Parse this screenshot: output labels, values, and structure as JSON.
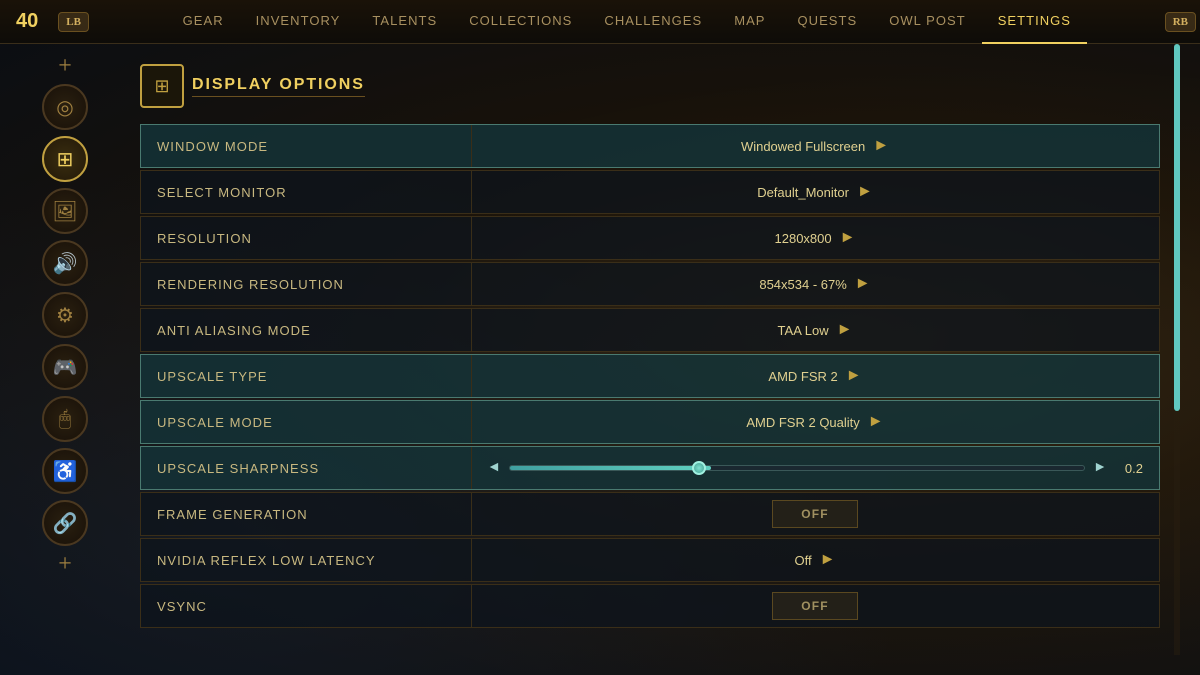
{
  "topbar": {
    "level": "40",
    "lb_label": "LB",
    "rb_label": "RB",
    "nav_items": [
      {
        "label": "GEAR",
        "active": false
      },
      {
        "label": "INVENTORY",
        "active": false
      },
      {
        "label": "TALENTS",
        "active": false
      },
      {
        "label": "COLLECTIONS",
        "active": false
      },
      {
        "label": "CHALLENGES",
        "active": false
      },
      {
        "label": "MAP",
        "active": false
      },
      {
        "label": "QUESTS",
        "active": false
      },
      {
        "label": "OWL POST",
        "active": false
      },
      {
        "label": "SETTINGS",
        "active": true
      }
    ]
  },
  "sidebar": {
    "icons": [
      {
        "name": "plus-top",
        "symbol": "+",
        "active": false
      },
      {
        "name": "disc",
        "symbol": "◎",
        "active": false
      },
      {
        "name": "display",
        "symbol": "⊞",
        "active": true
      },
      {
        "name": "image",
        "symbol": "🖼",
        "active": false
      },
      {
        "name": "audio",
        "symbol": "🔊",
        "active": false
      },
      {
        "name": "gear",
        "symbol": "⚙",
        "active": false
      },
      {
        "name": "gamepad",
        "symbol": "🎮",
        "active": false
      },
      {
        "name": "mouse",
        "symbol": "🖱",
        "active": false
      },
      {
        "name": "accessibility",
        "symbol": "♿",
        "active": false
      },
      {
        "name": "network",
        "symbol": "🔗",
        "active": false
      },
      {
        "name": "plus-bottom",
        "symbol": "+",
        "active": false
      }
    ]
  },
  "section": {
    "title": "DISPLAY OPTIONS",
    "icon": "⊞"
  },
  "settings": [
    {
      "label": "WINDOW MODE",
      "value": "Windowed Fullscreen",
      "type": "dropdown",
      "highlighted": true
    },
    {
      "label": "SELECT MONITOR",
      "value": "Default_Monitor",
      "type": "dropdown",
      "highlighted": false
    },
    {
      "label": "RESOLUTION",
      "value": "1280x800",
      "type": "dropdown",
      "highlighted": false
    },
    {
      "label": "RENDERING RESOLUTION",
      "value": "854x534 - 67%",
      "type": "dropdown",
      "highlighted": false
    },
    {
      "label": "ANTI ALIASING MODE",
      "value": "TAA Low",
      "type": "dropdown",
      "highlighted": false
    },
    {
      "label": "UPSCALE TYPE",
      "value": "AMD FSR 2",
      "type": "dropdown",
      "highlighted": true
    },
    {
      "label": "UPSCALE MODE",
      "value": "AMD FSR 2 Quality",
      "type": "dropdown",
      "highlighted": true
    },
    {
      "label": "UPSCALE SHARPNESS",
      "value": "0.2",
      "type": "slider",
      "highlighted": true,
      "slider_pct": 35
    },
    {
      "label": "FRAME GENERATION",
      "value": "OFF",
      "type": "toggle",
      "highlighted": false
    },
    {
      "label": "NVIDIA REFLEX LOW LATENCY",
      "value": "Off",
      "type": "dropdown",
      "highlighted": false
    },
    {
      "label": "VSYNC",
      "value": "OFF",
      "type": "toggle",
      "highlighted": false
    }
  ]
}
